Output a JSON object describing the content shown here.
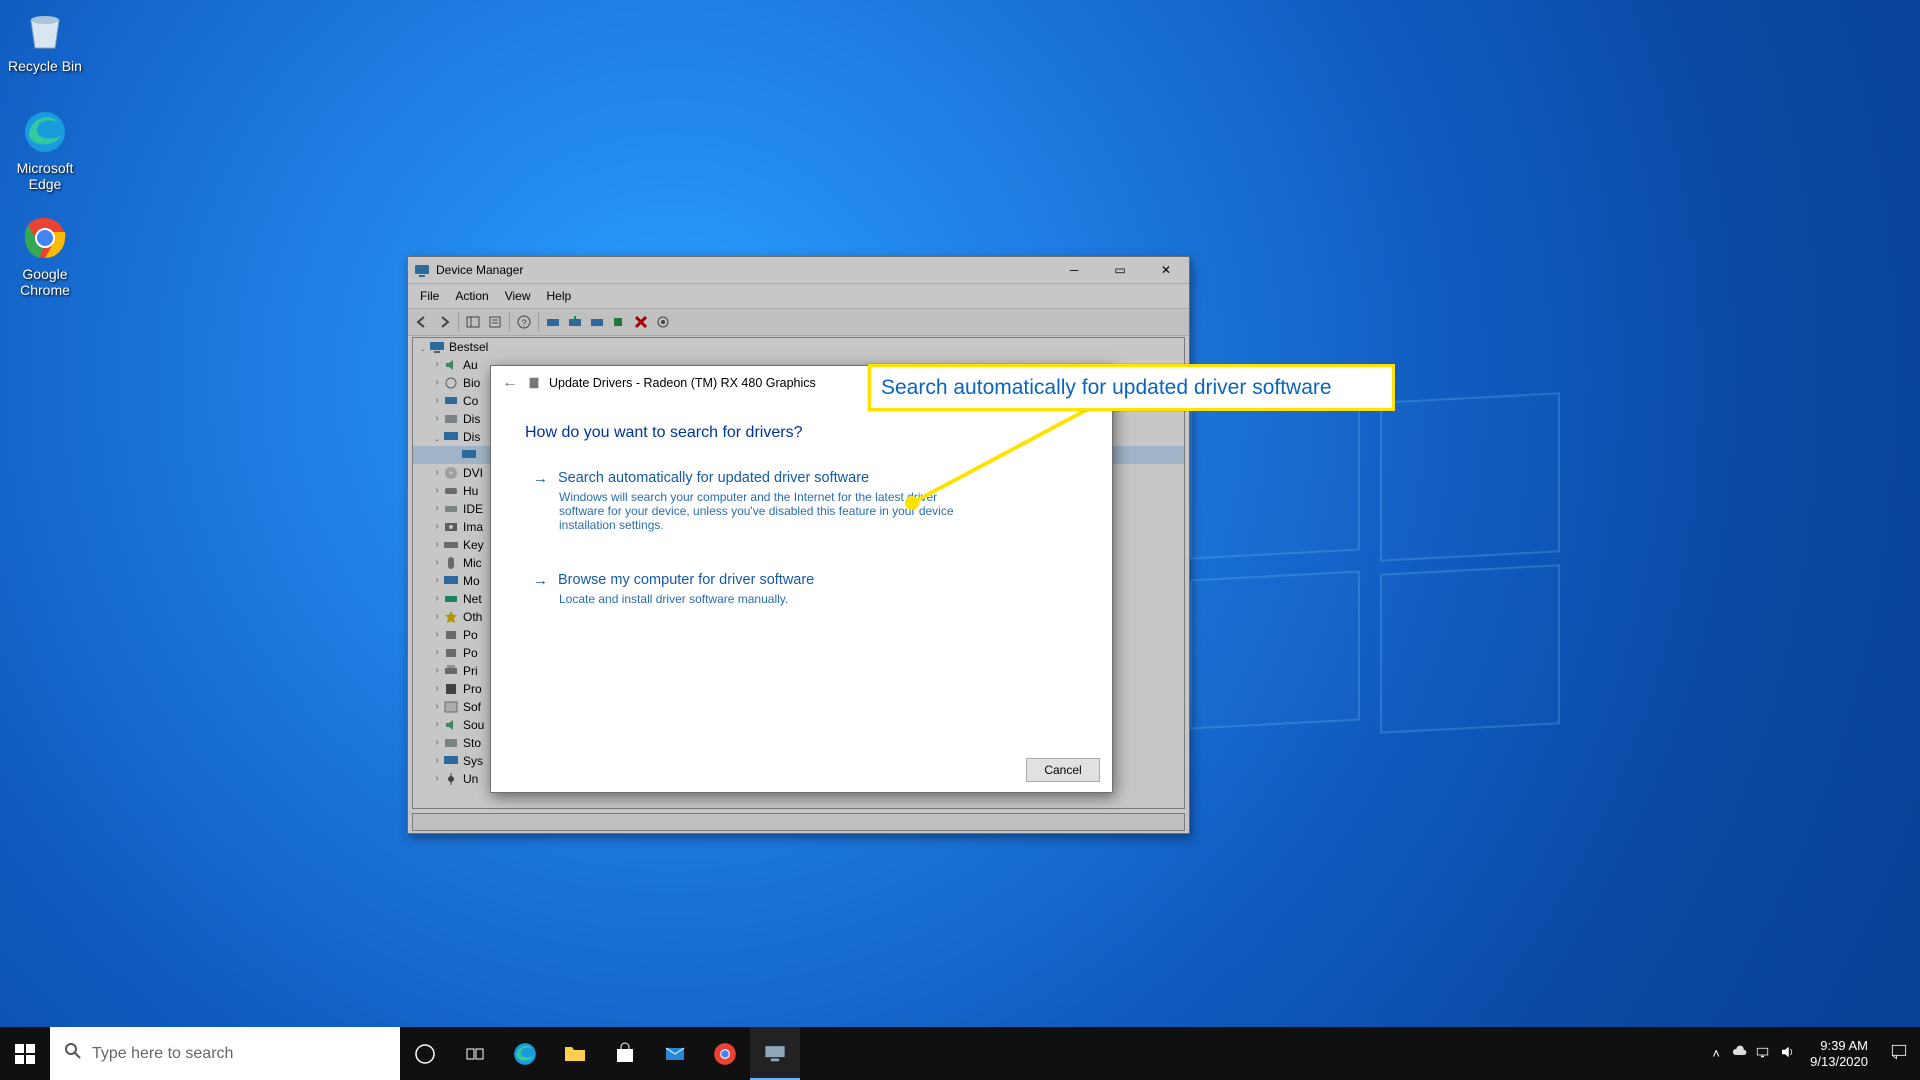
{
  "desktop_icons": {
    "recycle_bin": "Recycle Bin",
    "edge": "Microsoft Edge",
    "chrome": "Google Chrome"
  },
  "device_manager": {
    "title": "Device Manager",
    "menu": {
      "file": "File",
      "action": "Action",
      "view": "View",
      "help": "Help"
    },
    "root_node": "Bestsel",
    "nodes": {
      "n0": "Au",
      "n1": "Bio",
      "n2": "Co",
      "n3": "Dis",
      "n4": "Dis",
      "n5": "DVI",
      "n6": "Hu",
      "n7": "IDE",
      "n8": "Ima",
      "n9": "Key",
      "n10": "Mic",
      "n11": "Mo",
      "n12": "Net",
      "n13": "Oth",
      "n14": "Po",
      "n15": "Po",
      "n16": "Pri",
      "n17": "Pro",
      "n18": "Sof",
      "n19": "Sou",
      "n20": "Sto",
      "n21": "Sys",
      "n22": "Un"
    }
  },
  "update_dialog": {
    "title": "Update Drivers - Radeon (TM) RX 480 Graphics",
    "question": "How do you want to search for drivers?",
    "opt1_title": "Search automatically for updated driver software",
    "opt1_desc": "Windows will search your computer and the Internet for the latest driver software for your device, unless you've disabled this feature in your device installation settings.",
    "opt2_title": "Browse my computer for driver software",
    "opt2_desc": "Locate and install driver software manually.",
    "cancel": "Cancel"
  },
  "callout": {
    "text": "Search automatically for updated driver software"
  },
  "taskbar": {
    "search_placeholder": "Type here to search",
    "clock_time": "9:39 AM",
    "clock_date": "9/13/2020"
  }
}
